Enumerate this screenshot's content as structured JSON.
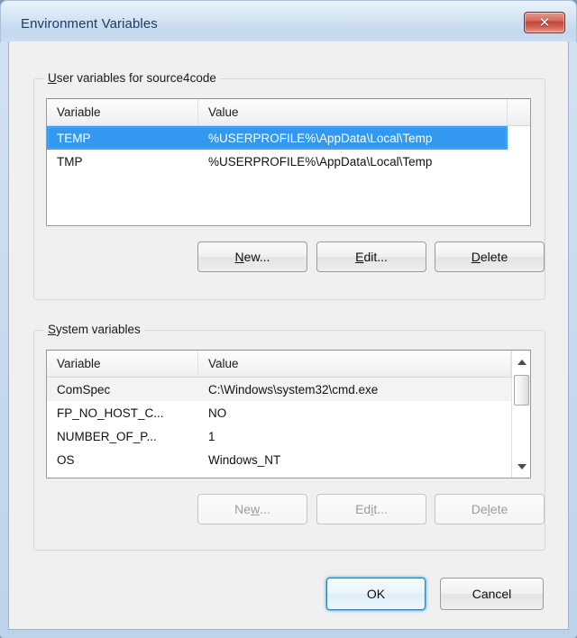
{
  "window": {
    "title": "Environment Variables",
    "close_icon": "close-icon",
    "close_glyph": "✕"
  },
  "user_section": {
    "legend_accel": "U",
    "legend_rest": "ser variables for source4code",
    "legend_full": "User variables for source4code",
    "columns": [
      "Variable",
      "Value"
    ],
    "rows": [
      {
        "variable": "TEMP",
        "value": "%USERPROFILE%\\AppData\\Local\\Temp",
        "selected": true
      },
      {
        "variable": "TMP",
        "value": "%USERPROFILE%\\AppData\\Local\\Temp",
        "selected": false
      }
    ],
    "buttons": {
      "new": {
        "pre": "",
        "accel": "N",
        "post": "ew...",
        "label": "New...",
        "enabled": true
      },
      "edit": {
        "pre": "",
        "accel": "E",
        "post": "dit...",
        "label": "Edit...",
        "enabled": true
      },
      "delete": {
        "pre": "",
        "accel": "D",
        "post": "elete",
        "label": "Delete",
        "enabled": true
      }
    }
  },
  "system_section": {
    "legend_accel": "S",
    "legend_rest": "ystem variables",
    "legend_full": "System variables",
    "columns": [
      "Variable",
      "Value"
    ],
    "rows": [
      {
        "variable": "ComSpec",
        "value": "C:\\Windows\\system32\\cmd.exe",
        "banded": true
      },
      {
        "variable": "FP_NO_HOST_C...",
        "value": "NO",
        "banded": false
      },
      {
        "variable": "NUMBER_OF_P...",
        "value": "1",
        "banded": false
      },
      {
        "variable": "OS",
        "value": "Windows_NT",
        "banded": false
      }
    ],
    "scrollbar": {
      "up_icon": "scroll-up-arrow-icon",
      "down_icon": "scroll-down-arrow-icon"
    },
    "buttons": {
      "new": {
        "pre": "Ne",
        "accel": "w",
        "post": "...",
        "label": "New...",
        "enabled": false
      },
      "edit": {
        "pre": "Ed",
        "accel": "i",
        "post": "t...",
        "label": "Edit...",
        "enabled": false
      },
      "delete": {
        "pre": "De",
        "accel": "l",
        "post": "ete",
        "label": "Delete",
        "enabled": false
      }
    }
  },
  "footer": {
    "ok": "OK",
    "cancel": "Cancel"
  },
  "colors": {
    "selection": "#3399f0",
    "dialog_bg": "#f0f0f0",
    "frame": "#c6d9ee",
    "close_red": "#c0453a",
    "default_focus": "#72c0f0"
  }
}
